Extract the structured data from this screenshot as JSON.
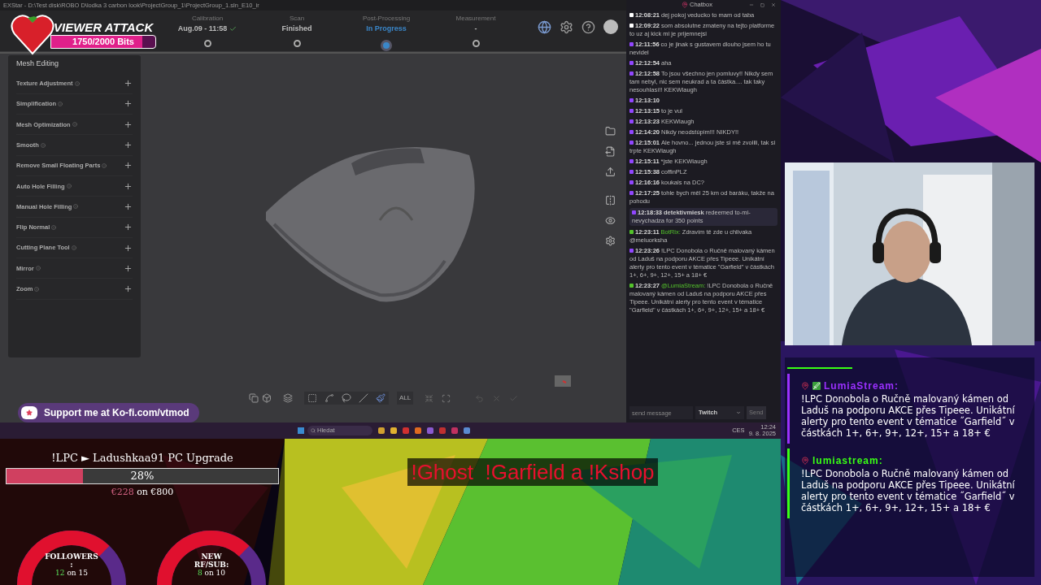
{
  "window": {
    "title": "EXStar - D:\\Test disk\\ROBO D\\lodka 3 carbon look\\ProjectGroup_1\\ProjectGroup_1.sln_E10_ir"
  },
  "workflow_steps": [
    {
      "label": "Calibration",
      "value": "Aug.09 - 11:58",
      "checked": true,
      "selected": false
    },
    {
      "label": "Scan",
      "value": "Finished",
      "checked": false,
      "selected": false
    },
    {
      "label": "Post-Processing",
      "value": "In Progress",
      "checked": false,
      "selected": true
    },
    {
      "label": "Measurement",
      "value": "-",
      "checked": false,
      "selected": false
    }
  ],
  "side_panel": {
    "title": "Mesh Editing",
    "items": [
      "Texture Adjustment",
      "Simplification",
      "Mesh Optimization",
      "Smooth",
      "Remove Small Floating Parts",
      "Auto Hole Filling",
      "Manual Hole Filling",
      "Flip Normal",
      "Cutting Plane Tool",
      "Mirror",
      "Zoom"
    ]
  },
  "toolbar": {
    "all_label": "ALL"
  },
  "chatbox": {
    "title": "Chatbox",
    "input_placeholder": "send message",
    "platform_select": "Twitch",
    "send_label": "Send",
    "messages": [
      {
        "kind": "message",
        "color": "#ffffff",
        "time": "12:08:21",
        "text": "dej pokoj veducko to mam od taba"
      },
      {
        "kind": "message",
        "color": "#ffffff",
        "time": "12:09:22",
        "text": "som absolutne zmateny na tejto platforme to uz aj kick mi je prijemnejsi"
      },
      {
        "kind": "message",
        "color": "#9146ff",
        "time": "12:11:56",
        "text": "co je jinak s gustavem dlouho jsem ho tu nevidel"
      },
      {
        "kind": "message",
        "color": "#9146ff",
        "time": "12:12:54",
        "text": "aha"
      },
      {
        "kind": "message",
        "color": "#9146ff",
        "time": "12:12:58",
        "text": "To jsou všechno jen pomluvy!! Nikdy sem tam nebyl, nic sem neukrad a ta částka.... tak taky nesouhlasí!! KEKWlaugh"
      },
      {
        "kind": "message",
        "color": "#9146ff",
        "time": "12:13:10"
      },
      {
        "kind": "message",
        "color": "#9146ff",
        "time": "12:13:15",
        "text": "to je vul"
      },
      {
        "kind": "message",
        "color": "#9146ff",
        "time": "12:13:23",
        "text": "KEKWlaugh"
      },
      {
        "kind": "message",
        "color": "#9146ff",
        "time": "12:14:20",
        "text": "Nikdy neodstúpim!!! NIKDY!!"
      },
      {
        "kind": "message",
        "color": "#9146ff",
        "time": "12:15:01",
        "text": "Ale hovno... jednou jste si mě zvolili, tak si trpte KEKWlaugh"
      },
      {
        "kind": "message",
        "color": "#9146ff",
        "time": "12:15:11",
        "text": "*jste KEKWlaugh"
      },
      {
        "kind": "message",
        "color": "#9146ff",
        "time": "12:15:38",
        "text": "coffinPLZ"
      },
      {
        "kind": "message",
        "color": "#9146ff",
        "time": "12:16:16",
        "text": "koukals na DC?"
      },
      {
        "kind": "message",
        "color": "#9146ff",
        "time": "12:17:25",
        "text": "tohle bych měl 25 km od baráku, takže na pohodu"
      },
      {
        "kind": "redemption",
        "color": "#9146ff",
        "time": "12:18:33",
        "user": "detektivmiesk",
        "text": "redeemed to-mi-nevychadza for 350 points"
      },
      {
        "kind": "message",
        "color": "#53c22b",
        "time": "12:23:11",
        "user": "BotRix:",
        "text": "Zdravím tě zde u chlivaka @meluorksha"
      },
      {
        "kind": "message",
        "color": "#9146ff",
        "time": "12:23:26",
        "text": "!LPC Donobola o Ručně malovaný kámen od Laduš na podporu AKCE přes Tipeee. Unikátní alerty pro tento event v tématice \"Garfield\" v částkách 1+, 6+, 9+, 12+, 15+ a 18+ €"
      },
      {
        "kind": "message",
        "color": "#53c22b",
        "time": "12:23:27",
        "user": "@LumiaStream:",
        "text": "!LPC Donobola o Ručně malovaný kámen od Laduš na podporu AKCE přes Tipeee. Unikátní alerty pro tento event v tématice \"Garfield\" v částkách 1+, 6+, 9+, 12+, 15+ a 18+ €"
      }
    ]
  },
  "taskbar": {
    "search_placeholder": "Hledat",
    "tray_label": "CES",
    "time": "12:24",
    "date": "9. 8. 2025"
  },
  "viewer_attack": {
    "title": "VIEWER ATTACK",
    "progress": "1750/2000 Bits",
    "level": 0.875
  },
  "kofi": {
    "text": "Support me at Ko-fi.com/vtmod"
  },
  "goal": {
    "title": "!LPC ► Ladushkaa91 PC Upgrade",
    "percent": "28%",
    "level": 0.28,
    "raised": "€228",
    "target": "on €800"
  },
  "gauges": [
    {
      "lines": [
        "FOLLOWERS",
        ":"
      ],
      "count": "12",
      "target": "on 15",
      "level": 0.8
    },
    {
      "lines": [
        "NEW",
        "RF/SUB:"
      ],
      "count": "8",
      "target": "on 10",
      "level": 0.8
    }
  ],
  "commands_banner": "!Ghost  !Garfield a !Kshop",
  "overlay_chat": [
    {
      "user": "LumiaStream:",
      "color": "#9b30ff",
      "badge": true,
      "text": "!LPC Donobola o Ručně malovaný kámen od Laduš na podporu AKCE přes Tipeee. Unikátní alerty pro tento event v tématice ˝Garfield˝ v částkách 1+, 6+, 9+, 12+, 15+ a 18+ €"
    },
    {
      "user": "lumiastream:",
      "color": "#39ff14",
      "badge": false,
      "text": "!LPC Donobola o Ručně malovaný kámen od Laduš na podporu AKCE přes Tipeee. Unikátní alerty pro tento event v tématice ˝Garfield˝ v částkách 1+, 6+, 9+, 12+, 15+ a 18+ €"
    }
  ]
}
